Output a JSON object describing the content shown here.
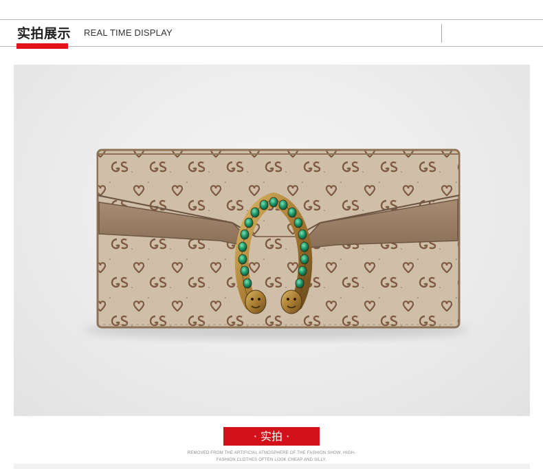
{
  "header": {
    "title_zh": "实拍展示",
    "title_en": "REAL TIME DISPLAY"
  },
  "photo": {
    "subject": "wallet-product-photo",
    "monogram": "GS"
  },
  "caption": {
    "badge_label": "· 实拍 ·",
    "subtext_line1": "REMOVED FROM THE ARTIFICIAL ATMOSPHERE OF THE FASHION SHOW, HIGH-",
    "subtext_line2": "FASHION CLOTHES OFTEN LOOK CHEAP AND SILLY."
  },
  "colors": {
    "accent_red": "#e1121a",
    "badge_red": "#d3111b",
    "canvas_beige": "#c9b7a0",
    "leather_taupe": "#9b8069",
    "monogram_brown": "#7d5a42",
    "brass": "#b58a3a",
    "emerald": "#1f9a6a"
  }
}
